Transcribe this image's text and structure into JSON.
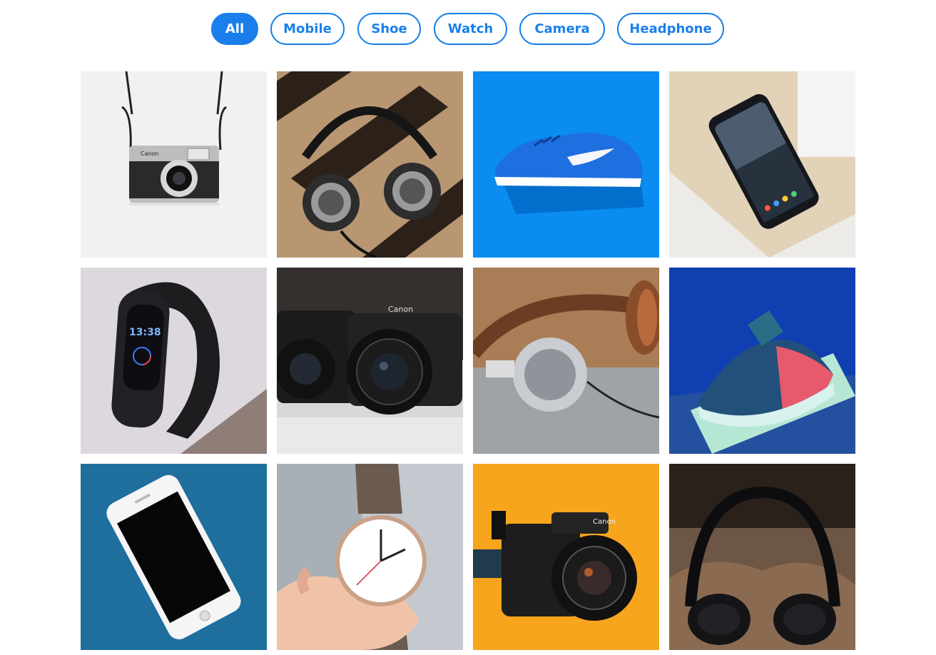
{
  "filters": {
    "items": [
      {
        "label": "All",
        "active": true
      },
      {
        "label": "Mobile",
        "active": false
      },
      {
        "label": "Shoe",
        "active": false
      },
      {
        "label": "Watch",
        "active": false
      },
      {
        "label": "Camera",
        "active": false
      },
      {
        "label": "Headphone",
        "active": false
      }
    ]
  },
  "gallery": {
    "items": [
      {
        "category": "camera",
        "brand_text": "Canon",
        "icon": "camera-photo"
      },
      {
        "category": "headphone",
        "icon": "headphone-photo"
      },
      {
        "category": "shoe",
        "icon": "shoe-photo"
      },
      {
        "category": "mobile",
        "icon": "mobile-photo"
      },
      {
        "category": "watch",
        "time_text": "13:38",
        "icon": "watch-photo"
      },
      {
        "category": "camera",
        "brand_text": "Canon",
        "icon": "camera-photo"
      },
      {
        "category": "headphone",
        "icon": "headphone-photo"
      },
      {
        "category": "shoe",
        "icon": "shoe-photo"
      },
      {
        "category": "mobile",
        "icon": "mobile-photo"
      },
      {
        "category": "watch",
        "icon": "watch-photo"
      },
      {
        "category": "camera",
        "brand_text": "Canon",
        "icon": "camera-photo"
      },
      {
        "category": "headphone",
        "icon": "headphone-photo"
      }
    ]
  },
  "colors": {
    "accent": "#1a7fea"
  }
}
